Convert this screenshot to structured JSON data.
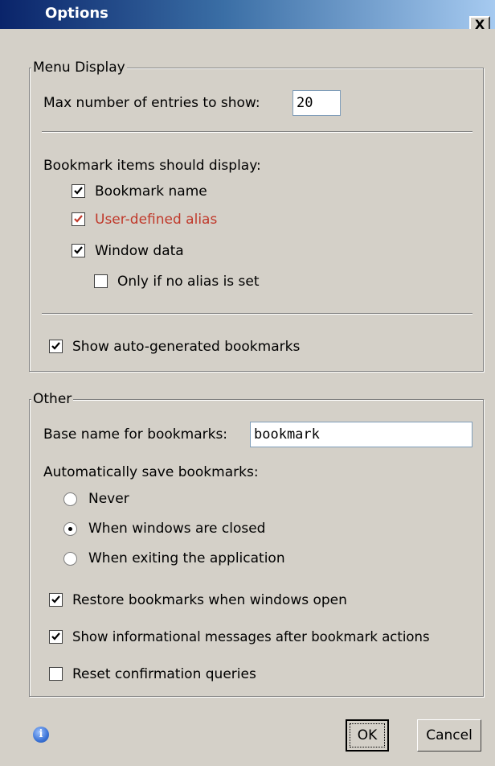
{
  "window": {
    "title": "Options",
    "close_glyph": "X"
  },
  "menu_display": {
    "legend": "Menu Display",
    "max_entries_label": "Max number of entries to show:",
    "max_entries_value": "20",
    "bookmark_items_label": "Bookmark items should display:",
    "items": [
      {
        "label": "Bookmark name",
        "checked": true,
        "color": "#000000"
      },
      {
        "label": "User-defined alias",
        "checked": true,
        "color": "#c0392b"
      },
      {
        "label": "Window data",
        "checked": true,
        "color": "#000000"
      }
    ],
    "only_if_no_alias": {
      "label": "Only if no alias is set",
      "checked": false
    },
    "show_auto_generated": {
      "label": "Show auto-generated bookmarks",
      "checked": true
    }
  },
  "other": {
    "legend": "Other",
    "base_name_label": "Base name for bookmarks:",
    "base_name_value": "bookmark",
    "auto_save_label": "Automatically save bookmarks:",
    "auto_save_options": [
      {
        "label": "Never",
        "selected": false
      },
      {
        "label": "When windows are closed",
        "selected": true
      },
      {
        "label": "When exiting the application",
        "selected": false
      }
    ],
    "restore_bookmarks": {
      "label": "Restore bookmarks when windows open",
      "checked": true
    },
    "show_messages": {
      "label": "Show informational messages after bookmark actions",
      "checked": true
    },
    "reset_queries": {
      "label": "Reset confirmation queries",
      "checked": false
    }
  },
  "footer": {
    "info_icon": "info-icon",
    "ok_label": "OK",
    "cancel_label": "Cancel"
  }
}
